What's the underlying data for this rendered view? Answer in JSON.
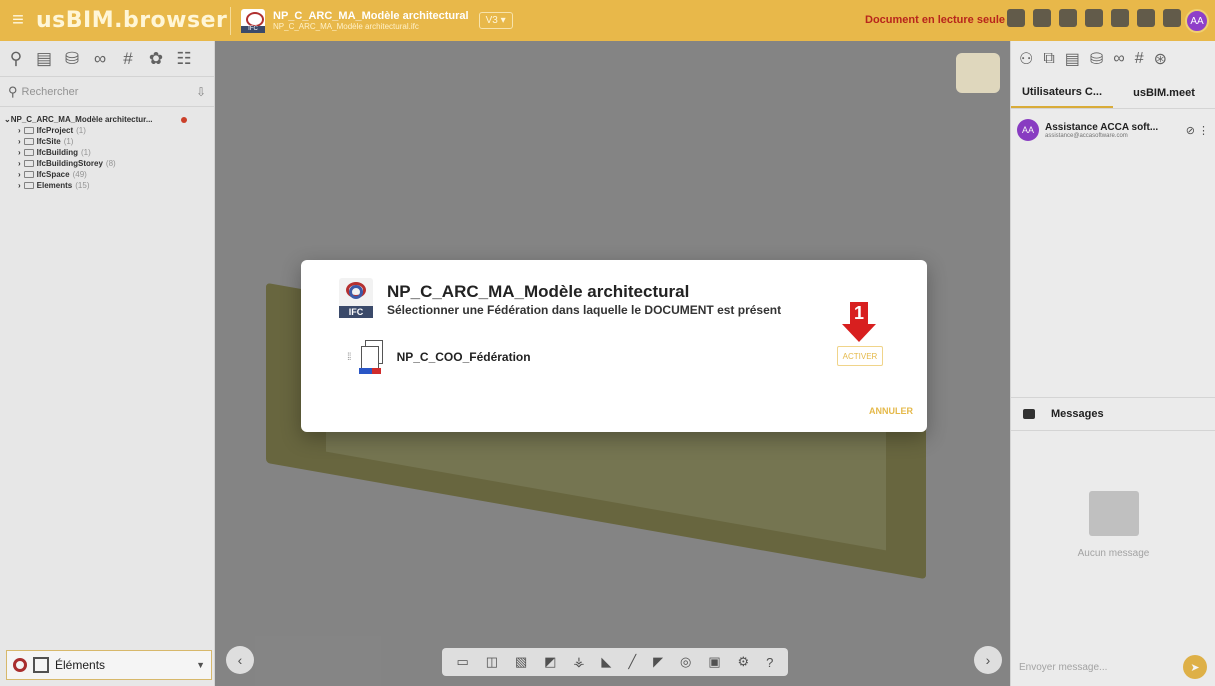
{
  "topbar": {
    "app_logo": "usBIM.browser",
    "doc_title": "NP_C_ARC_MA_Modèle architectural",
    "doc_subtitle": "NP_C_ARC_MA_Modèle architectural.ifc",
    "version": "V3 ▾",
    "readonly_label": "Document en lecture seule",
    "user_initials": "AA"
  },
  "left": {
    "search_placeholder": "Rechercher",
    "root_label": "NP_C_ARC_MA_Modèle architectur...",
    "tree": [
      {
        "label": "IfcProject",
        "count": "(1)"
      },
      {
        "label": "IfcSite",
        "count": "(1)"
      },
      {
        "label": "IfcBuilding",
        "count": "(1)"
      },
      {
        "label": "IfcBuildingStorey",
        "count": "(8)"
      },
      {
        "label": "IfcSpace",
        "count": "(49)"
      },
      {
        "label": "Elements",
        "count": "(15)"
      }
    ],
    "bottom_select": "Éléments"
  },
  "right": {
    "tabs": [
      "Utilisateurs C...",
      "usBIM.meet"
    ],
    "user": {
      "initials": "AA",
      "name": "Assistance ACCA soft...",
      "email": "assistance@accasoftware.com"
    },
    "messages_title": "Messages",
    "empty_text": "Aucun message",
    "message_placeholder": "Envoyer message..."
  },
  "dialog": {
    "title": "NP_C_ARC_MA_Modèle architectural",
    "subtitle": "Sélectionner une Fédération dans laquelle le DOCUMENT est présent",
    "federation_name": "NP_C_COO_Fédération",
    "activate_label": "ACTIVER",
    "cancel_label": "ANNULER",
    "step_marker": "1",
    "ifc_badge": "IFC"
  },
  "colors": {
    "accent": "#e8b84a",
    "danger": "#d81f1f",
    "avatar": "#8e3fc9"
  }
}
